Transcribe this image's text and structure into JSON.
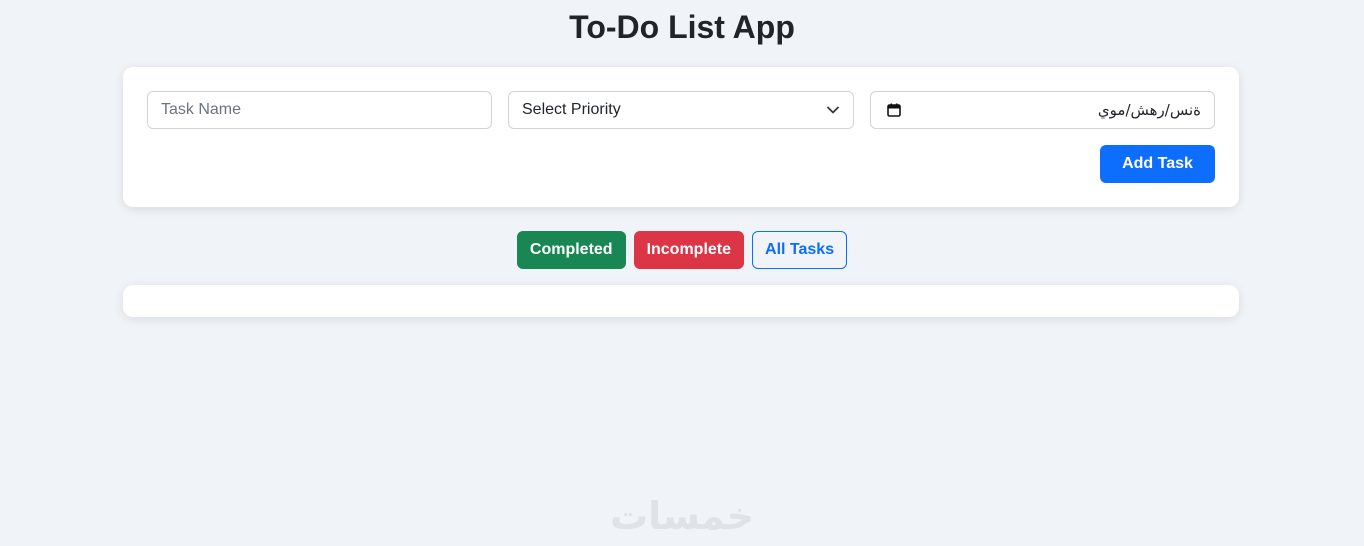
{
  "app": {
    "title": "To-Do List App"
  },
  "form": {
    "task_name_placeholder": "Task Name",
    "task_name_value": "",
    "priority_selected": "Select Priority",
    "due_date_value": "ةنس/رهش/موي",
    "add_button_label": "Add Task"
  },
  "filters": {
    "completed_label": "Completed",
    "incomplete_label": "Incomplete",
    "all_label": "All Tasks"
  },
  "tasks": [],
  "watermark": "خمسات",
  "colors": {
    "background": "#f0f3f8",
    "primary": "#0d6efd",
    "success": "#198754",
    "danger": "#dc3545"
  },
  "icons": {
    "priority_dropdown": "chevron-down-icon",
    "date_picker": "calendar-icon"
  }
}
